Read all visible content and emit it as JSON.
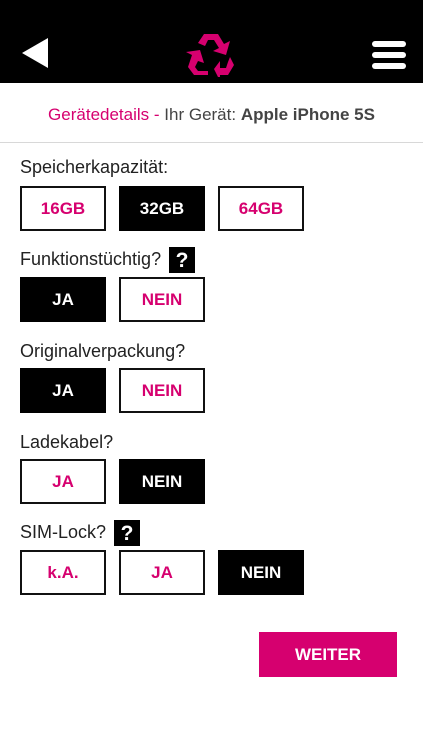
{
  "topbar": {
    "back_icon": "back-arrow-icon",
    "logo_icon": "recycle-icon",
    "menu_icon": "hamburger-menu-icon",
    "logo_color": "#d6006f"
  },
  "subheader": {
    "crumb": "Gerätedetails",
    "separator": " - ",
    "device_label": "Ihr Gerät: ",
    "device_name": "Apple iPhone 5S"
  },
  "questions": {
    "storage": {
      "label": "Speicherkapazität:",
      "options": [
        "16GB",
        "32GB",
        "64GB"
      ],
      "selected": "32GB"
    },
    "functional": {
      "label": "Funktionstüchtig?",
      "help": "?",
      "options": [
        "JA",
        "NEIN"
      ],
      "selected": "JA"
    },
    "packaging": {
      "label": "Originalverpackung?",
      "options": [
        "JA",
        "NEIN"
      ],
      "selected": "JA"
    },
    "cable": {
      "label": "Ladekabel?",
      "options": [
        "JA",
        "NEIN"
      ],
      "selected": "NEIN"
    },
    "simlock": {
      "label": "SIM-Lock?",
      "help": "?",
      "options": [
        "k.A.",
        "JA",
        "NEIN"
      ],
      "selected": "NEIN"
    }
  },
  "next_button": {
    "label": "WEITER"
  },
  "colors": {
    "accent": "#d6006f",
    "selected_bg": "#000000",
    "topbar_bg": "#000000"
  }
}
